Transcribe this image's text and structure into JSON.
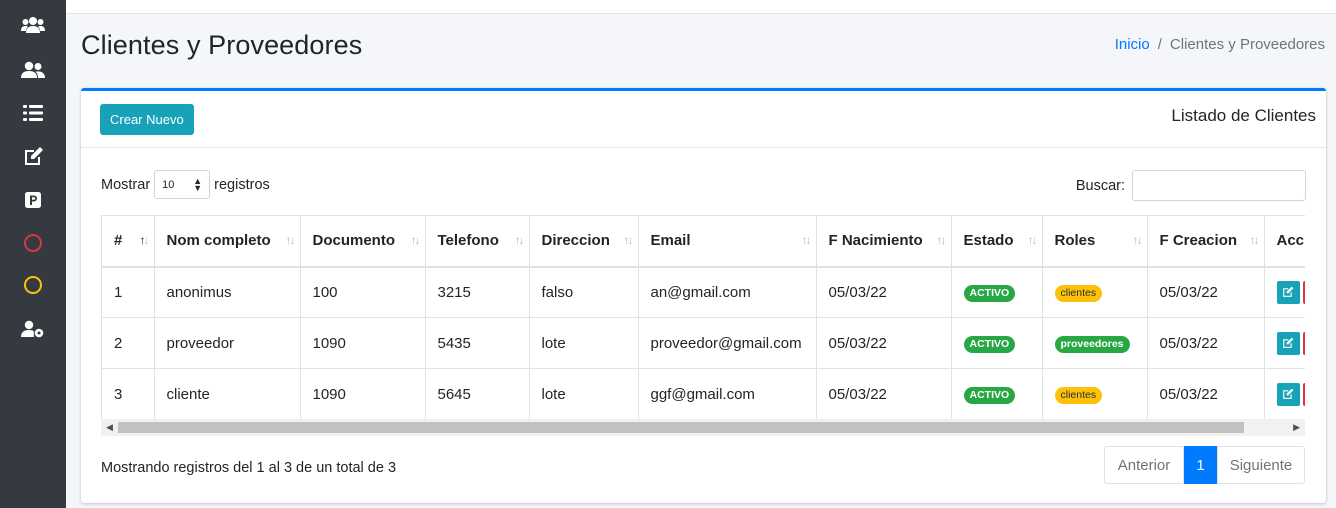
{
  "sidebar": {
    "icons": [
      "users-icon",
      "user-friends-icon",
      "list-icon",
      "edit-icon",
      "parking-icon",
      "circle-red-icon",
      "circle-yellow-icon",
      "users-cog-icon"
    ]
  },
  "header": {
    "title": "Clientes y Proveedores",
    "breadcrumb_home": "Inicio",
    "breadcrumb_sep": "/",
    "breadcrumb_current": "Clientes y Proveedores"
  },
  "card": {
    "create_button": "Crear Nuevo",
    "title": "Listado de Clientes",
    "show_label": "Mostrar",
    "show_value": "10",
    "show_suffix": "registros",
    "search_label": "Buscar:",
    "search_value": ""
  },
  "table": {
    "columns": [
      "#",
      "Nom completo",
      "Documento",
      "Telefono",
      "Direccion",
      "Email",
      "F Nacimiento",
      "Estado",
      "Roles",
      "F Creacion",
      "Acciones"
    ],
    "rows": [
      {
        "id": "1",
        "name": "anonimus",
        "doc": "100",
        "phone": "3215",
        "address": "falso",
        "email": "an@gmail.com",
        "birth": "05/03/22",
        "status": "ACTIVO",
        "role": "clientes",
        "created": "05/03/22"
      },
      {
        "id": "2",
        "name": "proveedor",
        "doc": "1090",
        "phone": "5435",
        "address": "lote",
        "email": "proveedor@gmail.com",
        "birth": "05/03/22",
        "status": "ACTIVO",
        "role": "proveedores",
        "created": "05/03/22"
      },
      {
        "id": "3",
        "name": "cliente",
        "doc": "1090",
        "phone": "5645",
        "address": "lote",
        "email": "ggf@gmail.com",
        "birth": "05/03/22",
        "status": "ACTIVO",
        "role": "clientes",
        "created": "05/03/22"
      }
    ]
  },
  "footer": {
    "info": "Mostrando registros del 1 al 3 de un total de 3",
    "prev": "Anterior",
    "page": "1",
    "next": "Siguiente"
  },
  "colors": {
    "primary": "#007bff",
    "info": "#17a2b8",
    "success": "#28a745",
    "warning": "#ffc107",
    "danger": "#dc3545",
    "sidebar": "#343a40"
  }
}
